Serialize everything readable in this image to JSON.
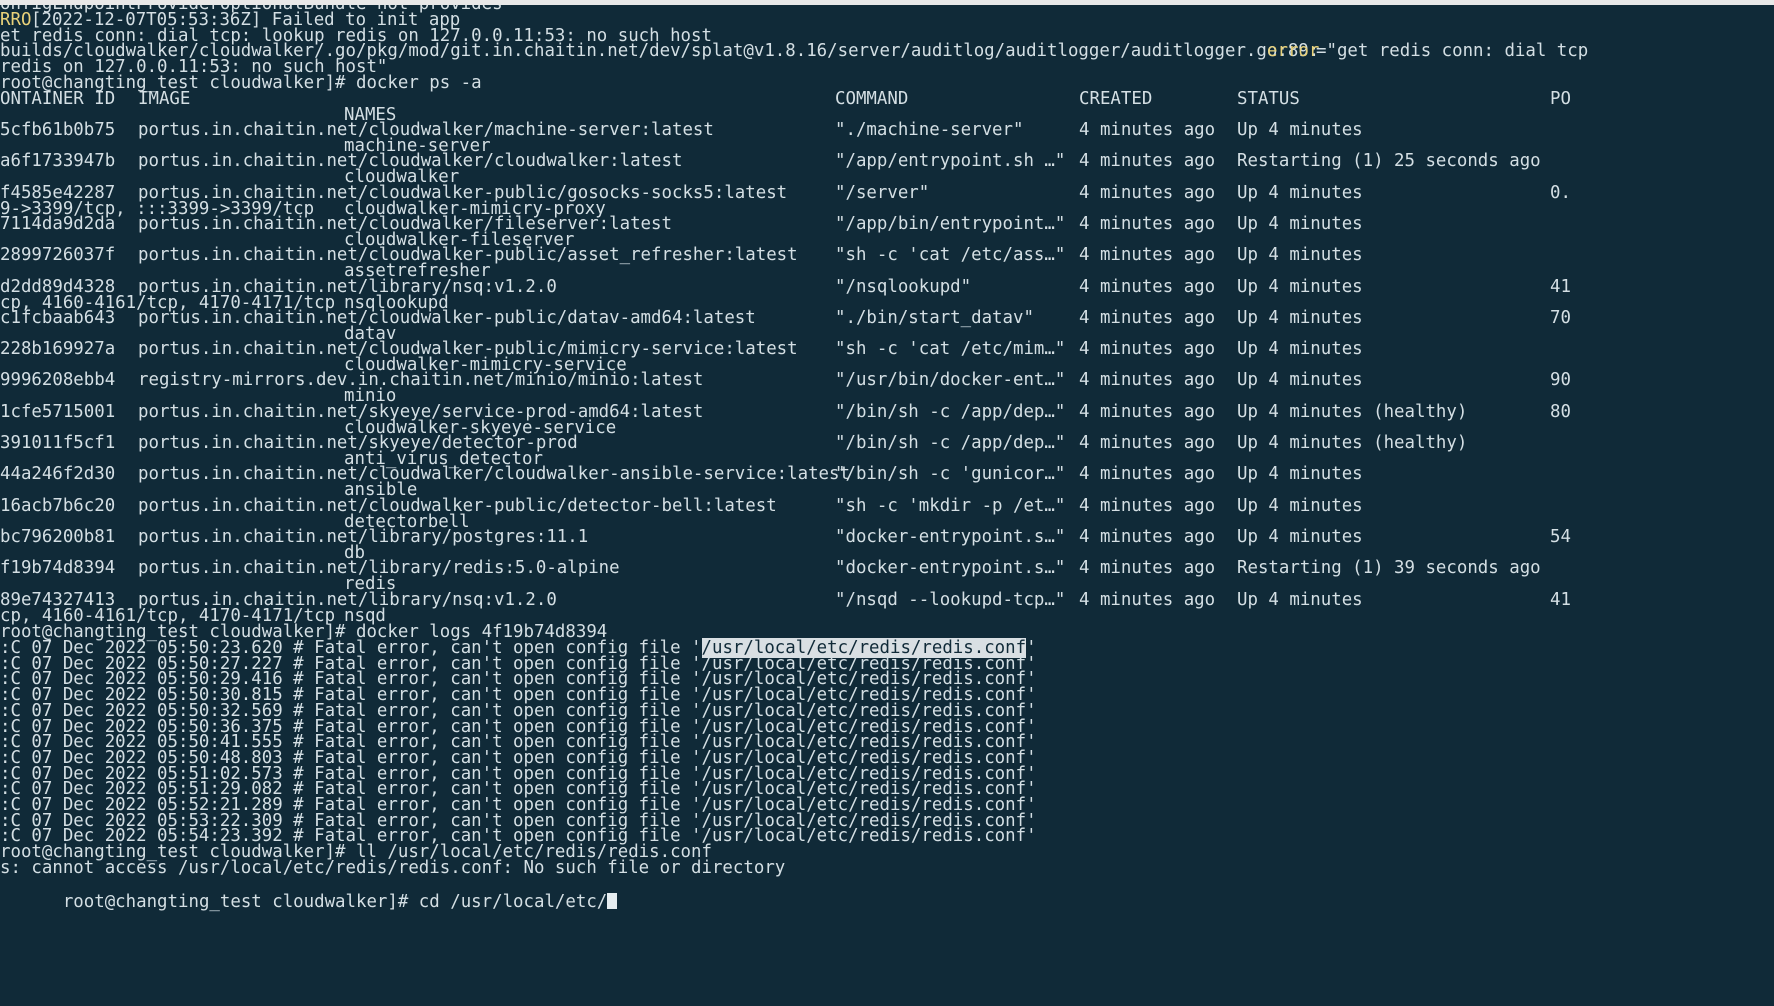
{
  "terminal": {
    "lines_top": {
      "clipped": "onfigEndpointProviderOptionalBundle not provides",
      "err_prefix": "RRO",
      "err_rest": "[2022-12-07T05:53:36Z] Failed to init app",
      "redis_conn": "et redis conn: dial tcp: lookup redis on 127.0.0.11:53: no such host",
      "builds_path": "builds/cloudwalker/cloudwalker/.go/pkg/mod/git.in.chaitin.net/dev/splat@v1.8.16/server/auditlog/auditlogger/auditlogger.go:89:",
      "builds_err_key": "error",
      "builds_err_val": "=\"get redis conn: dial tcp",
      "redis_host": "redis on 127.0.0.11:53: no such host\"",
      "prompt_ps": "root@changting_test cloudwalker]# docker ps -a"
    },
    "ps_headers": {
      "container_id": "ONTAINER ID",
      "image": "IMAGE",
      "command": "COMMAND",
      "created": "CREATED",
      "status": "STATUS",
      "ports": "PO",
      "names": "NAMES"
    },
    "containers": [
      {
        "id": "5cfb61b0b75",
        "image": "portus.in.chaitin.net/cloudwalker/machine-server:latest",
        "command": "\"./machine-server\"",
        "created": "4 minutes ago",
        "status": "Up 4 minutes",
        "ports": "",
        "ports_prefix": "",
        "name": "machine-server"
      },
      {
        "id": "a6f1733947b",
        "image": "portus.in.chaitin.net/cloudwalker/cloudwalker:latest",
        "command": "\"/app/entrypoint.sh …\"",
        "created": "4 minutes ago",
        "status": "Restarting (1) 25 seconds ago",
        "ports": "",
        "ports_prefix": "",
        "name": "cloudwalker"
      },
      {
        "id": "f4585e42287",
        "image": "portus.in.chaitin.net/cloudwalker-public/gosocks-socks5:latest",
        "command": "\"/server\"",
        "created": "4 minutes ago",
        "status": "Up 4 minutes",
        "ports": "0.",
        "ports_prefix": "9->3399/tcp, :::3399->3399/tcp",
        "name": "cloudwalker-mimicry-proxy"
      },
      {
        "id": "7114da9d2da",
        "image": "portus.in.chaitin.net/cloudwalker/fileserver:latest",
        "command": "\"/app/bin/entrypoint…\"",
        "created": "4 minutes ago",
        "status": "Up 4 minutes",
        "ports": "",
        "ports_prefix": "",
        "name": "cloudwalker-fileserver"
      },
      {
        "id": "2899726037f",
        "image": "portus.in.chaitin.net/cloudwalker-public/asset_refresher:latest",
        "command": "\"sh -c 'cat /etc/ass…\"",
        "created": "4 minutes ago",
        "status": "Up 4 minutes",
        "ports": "",
        "ports_prefix": "",
        "name": "assetrefresher"
      },
      {
        "id": "d2dd89d4328",
        "image": "portus.in.chaitin.net/library/nsq:v1.2.0",
        "command": "\"/nsqlookupd\"",
        "created": "4 minutes ago",
        "status": "Up 4 minutes",
        "ports": "41",
        "ports_prefix": "cp, 4160-4161/tcp, 4170-4171/tcp",
        "name": "nsqlookupd"
      },
      {
        "id": "c1fcbaab643",
        "image": "portus.in.chaitin.net/cloudwalker-public/datav-amd64:latest",
        "command": "\"./bin/start_datav\"",
        "created": "4 minutes ago",
        "status": "Up 4 minutes",
        "ports": "70",
        "ports_prefix": "",
        "name": "datav"
      },
      {
        "id": "228b169927a",
        "image": "portus.in.chaitin.net/cloudwalker-public/mimicry-service:latest",
        "command": "\"sh -c 'cat /etc/mim…\"",
        "created": "4 minutes ago",
        "status": "Up 4 minutes",
        "ports": "",
        "ports_prefix": "",
        "name": "cloudwalker-mimicry-service"
      },
      {
        "id": "9996208ebb4",
        "image": "registry-mirrors.dev.in.chaitin.net/minio/minio:latest",
        "command": "\"/usr/bin/docker-ent…\"",
        "created": "4 minutes ago",
        "status": "Up 4 minutes",
        "ports": "90",
        "ports_prefix": "",
        "name": "minio"
      },
      {
        "id": "1cfe5715001",
        "image": "portus.in.chaitin.net/skyeye/service-prod-amd64:latest",
        "command": "\"/bin/sh -c /app/dep…\"",
        "created": "4 minutes ago",
        "status": "Up 4 minutes (healthy)",
        "ports": "80",
        "ports_prefix": "",
        "name": "cloudwalker-skyeye-service"
      },
      {
        "id": "391011f5cf1",
        "image": "portus.in.chaitin.net/skyeye/detector-prod",
        "command": "\"/bin/sh -c /app/dep…\"",
        "created": "4 minutes ago",
        "status": "Up 4 minutes (healthy)",
        "ports": "",
        "ports_prefix": "",
        "name": "anti_virus_detector"
      },
      {
        "id": "44a246f2d30",
        "image": "portus.in.chaitin.net/cloudwalker/cloudwalker-ansible-service:latest",
        "command": "\"/bin/sh -c 'gunicor…\"",
        "created": "4 minutes ago",
        "status": "Up 4 minutes",
        "ports": "",
        "ports_prefix": "",
        "name": "ansible"
      },
      {
        "id": "16acb7b6c20",
        "image": "portus.in.chaitin.net/cloudwalker-public/detector-bell:latest",
        "command": "\"sh -c 'mkdir -p /et…\"",
        "created": "4 minutes ago",
        "status": "Up 4 minutes",
        "ports": "",
        "ports_prefix": "",
        "name": "detectorbell"
      },
      {
        "id": "bc796200b81",
        "image": "portus.in.chaitin.net/library/postgres:11.1",
        "command": "\"docker-entrypoint.s…\"",
        "created": "4 minutes ago",
        "status": "Up 4 minutes",
        "ports": "54",
        "ports_prefix": "",
        "name": "db"
      },
      {
        "id": "f19b74d8394",
        "image": "portus.in.chaitin.net/library/redis:5.0-alpine",
        "command": "\"docker-entrypoint.s…\"",
        "created": "4 minutes ago",
        "status": "Restarting (1) 39 seconds ago",
        "ports": "",
        "ports_prefix": "",
        "name": "redis"
      },
      {
        "id": "89e74327413",
        "image": "portus.in.chaitin.net/library/nsq:v1.2.0",
        "command": "\"/nsqd --lookupd-tcp…\"",
        "created": "4 minutes ago",
        "status": "Up 4 minutes",
        "ports": "41",
        "ports_prefix": "cp, 4160-4161/tcp, 4170-4171/tcp",
        "name": "nsqd"
      }
    ],
    "prompt_logs": "root@changting_test cloudwalker]# docker logs 4f19b74d8394",
    "log_lines": [
      {
        "ts": ":C 07 Dec 2022 05:50:23.620",
        "msg": " # Fatal error, can't open config file '",
        "path": "/usr/local/etc/redis/redis.conf",
        "end": "'"
      },
      {
        "ts": ":C 07 Dec 2022 05:50:27.227",
        "msg": " # Fatal error, can't open config file '",
        "path": "/usr/local/etc/redis/redis.conf",
        "end": "'"
      },
      {
        "ts": ":C 07 Dec 2022 05:50:29.416",
        "msg": " # Fatal error, can't open config file '",
        "path": "/usr/local/etc/redis/redis.conf",
        "end": "'"
      },
      {
        "ts": ":C 07 Dec 2022 05:50:30.815",
        "msg": " # Fatal error, can't open config file '",
        "path": "/usr/local/etc/redis/redis.conf",
        "end": "'"
      },
      {
        "ts": ":C 07 Dec 2022 05:50:32.569",
        "msg": " # Fatal error, can't open config file '",
        "path": "/usr/local/etc/redis/redis.conf",
        "end": "'"
      },
      {
        "ts": ":C 07 Dec 2022 05:50:36.375",
        "msg": " # Fatal error, can't open config file '",
        "path": "/usr/local/etc/redis/redis.conf",
        "end": "'"
      },
      {
        "ts": ":C 07 Dec 2022 05:50:41.555",
        "msg": " # Fatal error, can't open config file '",
        "path": "/usr/local/etc/redis/redis.conf",
        "end": "'"
      },
      {
        "ts": ":C 07 Dec 2022 05:50:48.803",
        "msg": " # Fatal error, can't open config file '",
        "path": "/usr/local/etc/redis/redis.conf",
        "end": "'"
      },
      {
        "ts": ":C 07 Dec 2022 05:51:02.573",
        "msg": " # Fatal error, can't open config file '",
        "path": "/usr/local/etc/redis/redis.conf",
        "end": "'"
      },
      {
        "ts": ":C 07 Dec 2022 05:51:29.082",
        "msg": " # Fatal error, can't open config file '",
        "path": "/usr/local/etc/redis/redis.conf",
        "end": "'"
      },
      {
        "ts": ":C 07 Dec 2022 05:52:21.289",
        "msg": " # Fatal error, can't open config file '",
        "path": "/usr/local/etc/redis/redis.conf",
        "end": "'"
      },
      {
        "ts": ":C 07 Dec 2022 05:53:22.309",
        "msg": " # Fatal error, can't open config file '",
        "path": "/usr/local/etc/redis/redis.conf",
        "end": "'"
      },
      {
        "ts": ":C 07 Dec 2022 05:54:23.392",
        "msg": " # Fatal error, can't open config file '",
        "path": "/usr/local/etc/redis/redis.conf",
        "end": "'"
      }
    ],
    "prompt_ll": "root@changting_test cloudwalker]# ll /usr/local/etc/redis/redis.conf",
    "ll_error": "s: cannot access /usr/local/etc/redis/redis.conf: No such file or directory",
    "prompt_cd": "root@changting_test cloudwalker]# cd /usr/local/etc/",
    "colors": {
      "background": "#102a38",
      "foreground": "#d4dfe4",
      "error_accent": "#e9d27a",
      "selection": "#d9dfe3"
    }
  }
}
